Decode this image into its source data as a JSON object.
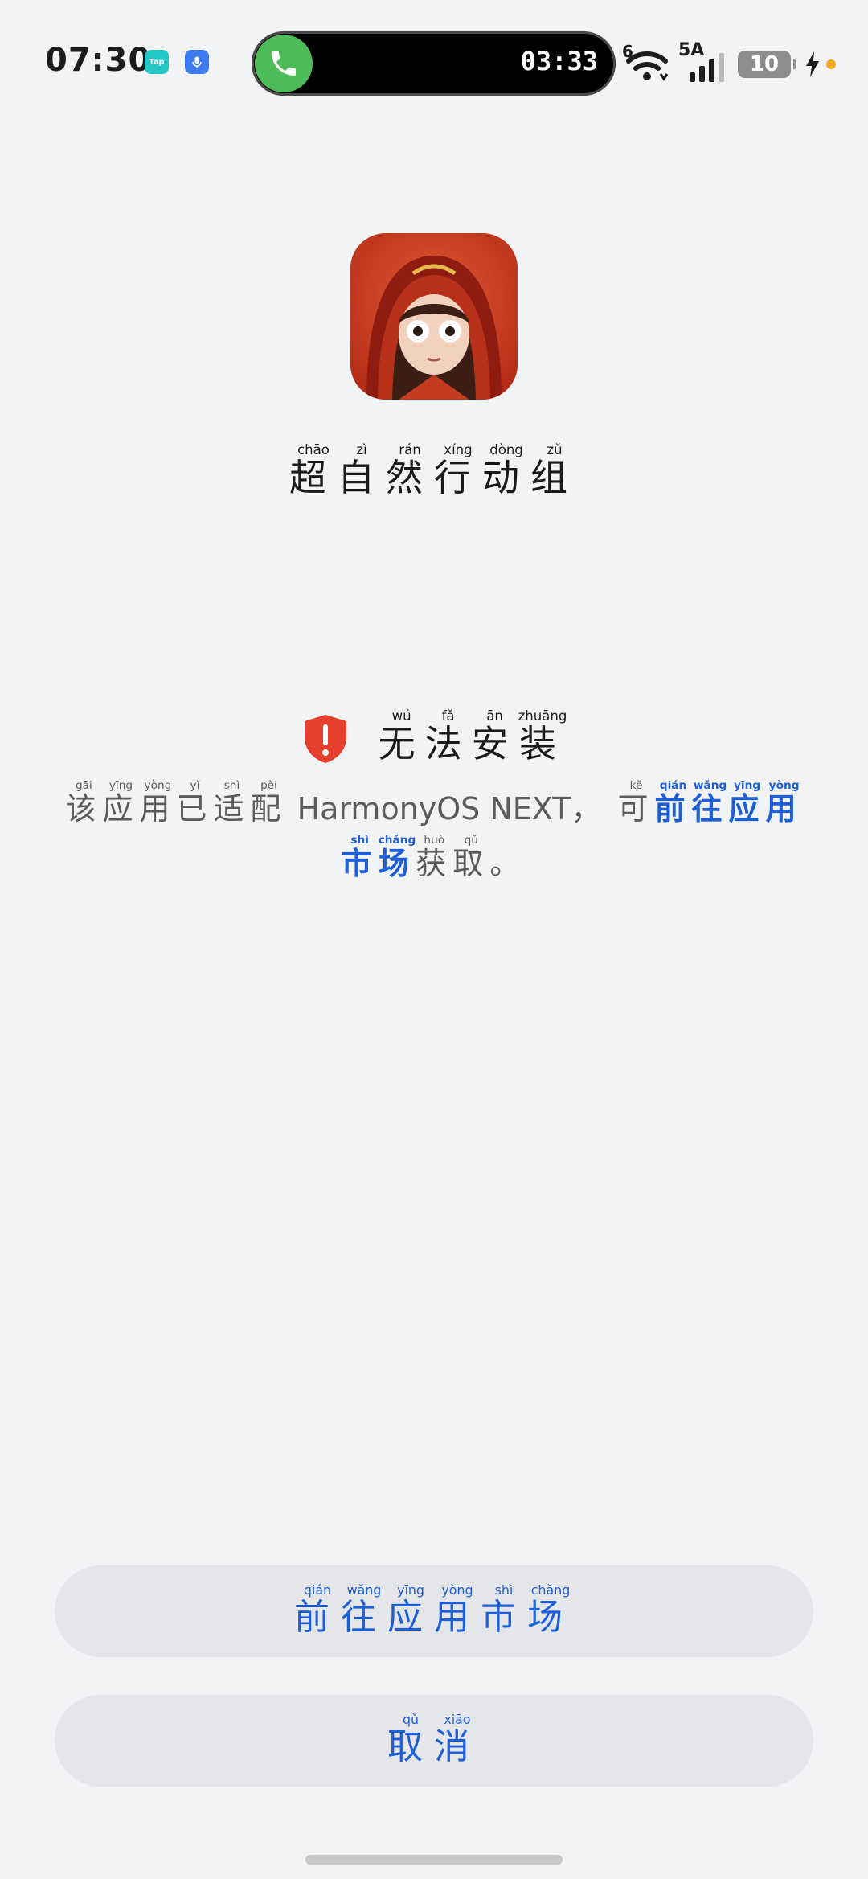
{
  "status_bar": {
    "time": "07:30",
    "mini_apps": [
      {
        "name": "taptap-icon",
        "label": "Tap"
      },
      {
        "name": "voice-assistant-icon",
        "label": ""
      }
    ],
    "call": {
      "timer": "03:33"
    },
    "wifi_tag": "6",
    "signal_tag": "5A",
    "battery_level": "10",
    "charging": true
  },
  "app": {
    "name_chars": [
      {
        "hanzi": "超",
        "pinyin": "chāo"
      },
      {
        "hanzi": "自",
        "pinyin": "zì"
      },
      {
        "hanzi": "然",
        "pinyin": "rán"
      },
      {
        "hanzi": "行",
        "pinyin": "xíng"
      },
      {
        "hanzi": "动",
        "pinyin": "dòng"
      },
      {
        "hanzi": "组",
        "pinyin": "zǔ"
      }
    ]
  },
  "notice": {
    "title_chars": [
      {
        "hanzi": "无",
        "pinyin": "wú"
      },
      {
        "hanzi": "法",
        "pinyin": "fǎ"
      },
      {
        "hanzi": "安",
        "pinyin": "ān"
      },
      {
        "hanzi": "装",
        "pinyin": "zhuāng"
      }
    ],
    "message_part1": [
      {
        "hanzi": "该",
        "pinyin": "gāi"
      },
      {
        "hanzi": "应",
        "pinyin": "yīng"
      },
      {
        "hanzi": "用",
        "pinyin": "yòng"
      },
      {
        "hanzi": "已",
        "pinyin": "yǐ"
      },
      {
        "hanzi": "适",
        "pinyin": "shì"
      },
      {
        "hanzi": "配",
        "pinyin": "pèi"
      }
    ],
    "platform": "HarmonyOS NEXT",
    "comma": "，",
    "message_part2": [
      {
        "hanzi": "可",
        "pinyin": "kě"
      }
    ],
    "link_chars": [
      {
        "hanzi": "前",
        "pinyin": "qián"
      },
      {
        "hanzi": "往",
        "pinyin": "wǎng"
      },
      {
        "hanzi": "应",
        "pinyin": "yīng"
      },
      {
        "hanzi": "用",
        "pinyin": "yòng"
      },
      {
        "hanzi": "市",
        "pinyin": "shì"
      },
      {
        "hanzi": "场",
        "pinyin": "chǎng"
      }
    ],
    "message_end": [
      {
        "hanzi": "获",
        "pinyin": "huò"
      },
      {
        "hanzi": "取",
        "pinyin": "qǔ"
      }
    ],
    "period": "。"
  },
  "buttons": {
    "market": [
      {
        "hanzi": "前",
        "pinyin": "qián"
      },
      {
        "hanzi": "往",
        "pinyin": "wǎng"
      },
      {
        "hanzi": "应",
        "pinyin": "yīng"
      },
      {
        "hanzi": "用",
        "pinyin": "yòng"
      },
      {
        "hanzi": "市",
        "pinyin": "shì"
      },
      {
        "hanzi": "场",
        "pinyin": "chǎng"
      }
    ],
    "cancel": [
      {
        "hanzi": "取",
        "pinyin": "qǔ"
      },
      {
        "hanzi": "消",
        "pinyin": "xiāo"
      }
    ]
  },
  "colors": {
    "accent": "#1f5fd6",
    "background": "#f1f3f5",
    "button_bg": "#e4e6e9",
    "shield": "#e53e2c",
    "call_green": "#4cbb58"
  }
}
